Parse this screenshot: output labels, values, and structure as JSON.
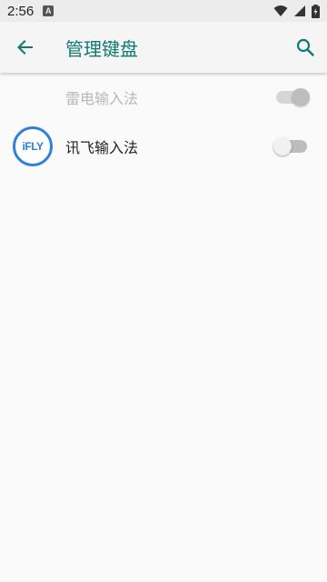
{
  "status_bar": {
    "time": "2:56",
    "notification_badge": "A",
    "icons": [
      "wifi-icon",
      "signal-icon",
      "battery-icon"
    ]
  },
  "app_bar": {
    "title": "管理键盘",
    "back_icon": "arrow-left-icon",
    "search_icon": "search-icon",
    "accent_color": "#0f7b72"
  },
  "keyboards": [
    {
      "label": "雷电输入法",
      "enabled": true,
      "disabled": true,
      "icon": ""
    },
    {
      "label": "讯飞输入法",
      "enabled": false,
      "disabled": false,
      "icon": "ifly-logo",
      "logo_text": "iFLY"
    }
  ]
}
